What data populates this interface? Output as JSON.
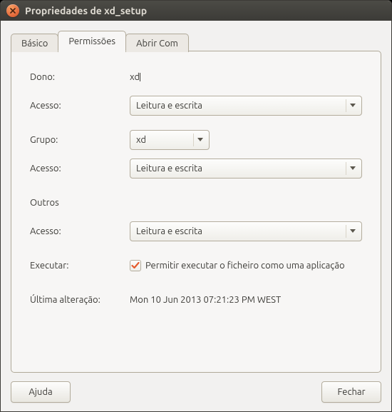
{
  "window": {
    "title": "Propriedades de xd_setup"
  },
  "tabs": {
    "basic": "Básico",
    "permissions": "Permissões",
    "openwith": "Abrir Com"
  },
  "labels": {
    "owner": "Dono:",
    "access": "Acesso:",
    "group": "Grupo:",
    "others": "Outros",
    "execute": "Executar:",
    "last_change": "Última alteração:"
  },
  "values": {
    "owner": "xd",
    "owner_access": "Leitura e escrita",
    "group": "xd",
    "group_access": "Leitura e escrita",
    "others_access": "Leitura e escrita",
    "execute_label": "Permitir executar o ficheiro como uma aplicação",
    "last_change": "Mon 10 Jun 2013 07:21:23 PM WEST"
  },
  "buttons": {
    "help": "Ajuda",
    "close": "Fechar"
  }
}
